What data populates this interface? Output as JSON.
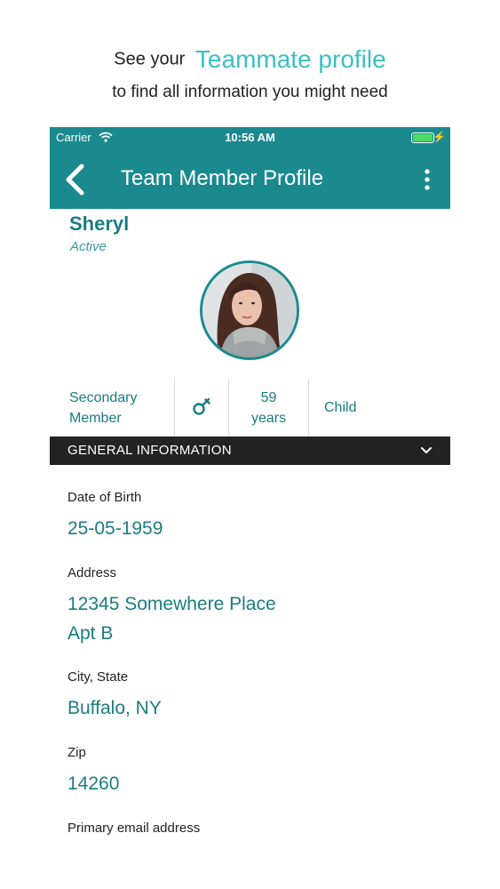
{
  "promo": {
    "lead": "See your",
    "highlight": "Teammate profile",
    "subline": "to find all information you might need"
  },
  "status_bar": {
    "carrier": "Carrier",
    "time": "10:56 AM",
    "charge_glyph": "⚡"
  },
  "nav": {
    "title": "Team Member Profile"
  },
  "member": {
    "name": "Sheryl",
    "status": "Active"
  },
  "info": {
    "role_line1": "Secondary",
    "role_line2": "Member",
    "gender_glyph": "⚦",
    "age_value": "59",
    "age_unit": "years",
    "relation": "Child"
  },
  "section": {
    "title": "GENERAL INFORMATION"
  },
  "fields": {
    "dob_label": "Date of Birth",
    "dob_value": "25-05-1959",
    "address_label": "Address",
    "address_line1": "12345 Somewhere Place",
    "address_line2": "Apt B",
    "city_label": "City, State",
    "city_value": "Buffalo, NY",
    "zip_label": "Zip",
    "zip_value": "14260",
    "email_label": "Primary email address"
  },
  "colors": {
    "brand": "#1b8a8f",
    "accent": "#3bbfc6",
    "section_bar": "#232323"
  },
  "icons": [
    "wifi-icon",
    "battery-icon",
    "back-icon",
    "more-icon",
    "gender-icon",
    "chevron-down-icon"
  ]
}
